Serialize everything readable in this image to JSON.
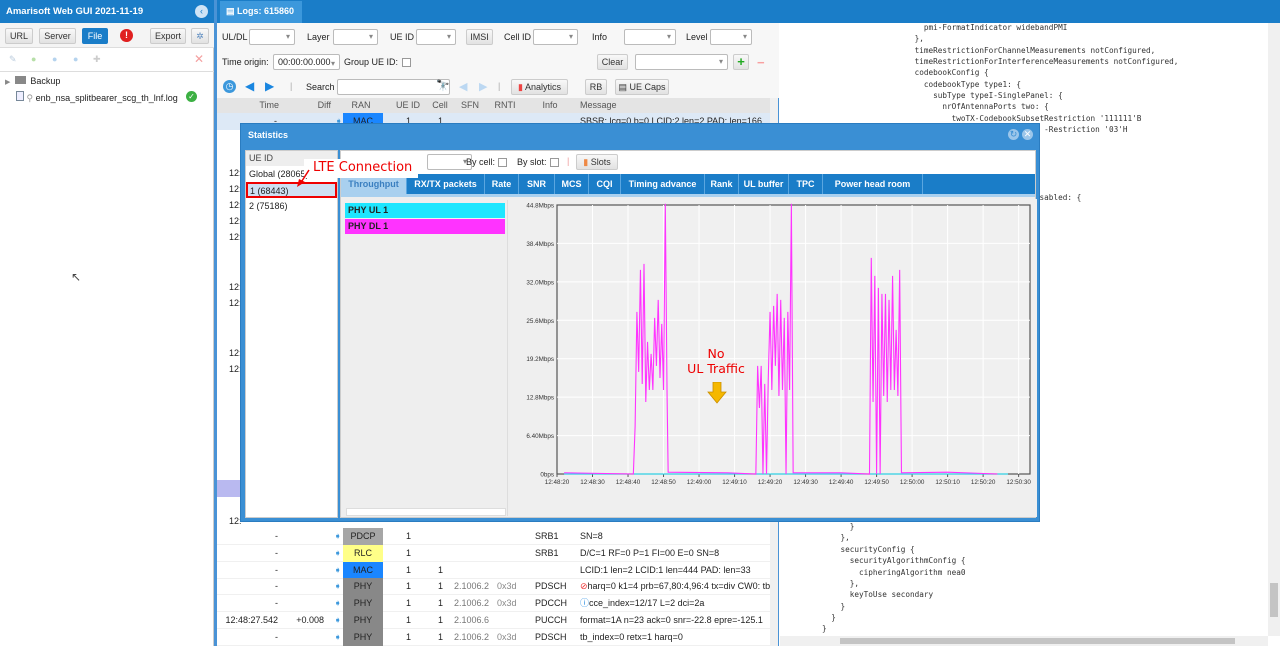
{
  "left": {
    "title": "Amarisoft Web GUI 2021-11-19",
    "buttons": {
      "url": "URL",
      "server": "Server",
      "file": "File",
      "export": "Export"
    },
    "tree": {
      "folder": "Backup",
      "file": "enb_nsa_splitbearer_scg_th_lnf.log"
    }
  },
  "logs": {
    "tab": "Logs: 615860",
    "filters": {
      "uldl": "UL/DL",
      "layer": "Layer",
      "ueid": "UE ID",
      "imsi": "IMSI",
      "cellid": "Cell ID",
      "info": "Info",
      "level": "Level"
    },
    "time_origin_label": "Time origin:",
    "time_origin": "00:00:00.000",
    "group_ue": "Group UE ID:",
    "clear": "Clear",
    "search_label": "Search",
    "analytics": "Analytics",
    "rb": "RB",
    "uecaps": "UE Caps",
    "columns": [
      "Time",
      "Diff",
      "RAN",
      "UE ID",
      "Cell",
      "SFN",
      "RNTI",
      "Info",
      "Message"
    ],
    "first_row": {
      "time": "-",
      "ran": "MAC",
      "ue": "1",
      "cell": "1",
      "msg": "SBSR: lcg=0 b=0 LCID:2 len=2 PAD: len=166"
    },
    "partial_time": "12:",
    "rows": [
      {
        "time": "-",
        "diff": "",
        "ran": "PDCP",
        "ue": "1",
        "cell": "",
        "sfn": "",
        "rnti": "",
        "info": "SRB1",
        "msg": "SN=8"
      },
      {
        "time": "-",
        "diff": "",
        "ran": "RLC",
        "ue": "1",
        "cell": "",
        "sfn": "",
        "rnti": "",
        "info": "SRB1",
        "msg": "D/C=1 RF=0 P=1 FI=00 E=0 SN=8"
      },
      {
        "time": "-",
        "diff": "",
        "ran": "MAC",
        "ue": "1",
        "cell": "1",
        "sfn": "",
        "rnti": "",
        "info": "",
        "msg": "LCID:1 len=2 LCID:1 len=444 PAD: len=33"
      },
      {
        "time": "-",
        "diff": "",
        "ran": "PHY",
        "ue": "1",
        "cell": "1",
        "sfn": "2.1006.2",
        "rnti": "0x3d",
        "info": "PDSCH",
        "msg": "harq=0 k1=4 prb=67,80:4,96:4 tx=div CW0: tb"
      },
      {
        "time": "-",
        "diff": "",
        "ran": "PHY",
        "ue": "1",
        "cell": "1",
        "sfn": "2.1006.2",
        "rnti": "0x3d",
        "info": "PDCCH",
        "msg": "cce_index=12/17 L=2 dci=2a"
      },
      {
        "time": "12:48:27.542",
        "diff": "+0.008",
        "ran": "PHY",
        "ue": "1",
        "cell": "1",
        "sfn": "2.1006.6",
        "rnti": "",
        "info": "PUCCH",
        "msg": "format=1A n=23 ack=0 snr=-22.8 epre=-125.1"
      },
      {
        "time": "-",
        "diff": "",
        "ran": "PHY",
        "ue": "1",
        "cell": "1",
        "sfn": "2.1006.2",
        "rnti": "0x3d",
        "info": "PDSCH",
        "msg": "tb_index=0 retx=1 harq=0"
      }
    ]
  },
  "ran_colors": {
    "MAC": "#1a86ff",
    "PDCP": "#a6a6a6",
    "RLC": "#ffff88",
    "PHY": "#888888"
  },
  "code": {
    "lines": [
      "                              pmi-FormatIndicator widebandPMI",
      "                            },",
      "                            timeRestrictionForChannelMeasurements notConfigured,",
      "                            timeRestrictionForInterferenceMeasurements notConfigured,",
      "                            codebookConfig {",
      "                              codebookType type1: {",
      "                                subType typeI-SinglePanel: {",
      "                                  nrOfAntennaPorts two: {",
      "                                    twoTX-CodebookSubsetRestriction '111111'B",
      "                                                        -Restriction '03'H",
      "",
      "",
      "",
      "",
      "",
      "                                                       sabled: {",
      "",
      "",
      "",
      "",
      "",
      "",
      "",
      "",
      "",
      "",
      "",
      "",
      "",
      "",
      "",
      "",
      "",
      "",
      "",
      "",
      "",
      "",
      "",
      "",
      "",
      "",
      "",
      "",
      "              }",
      "            },",
      "            securityConfig {",
      "              securityAlgorithmConfig {",
      "                cipheringAlgorithm nea0",
      "              },",
      "              keyToUse secondary",
      "            }",
      "          }",
      "        }"
    ]
  },
  "stats": {
    "title": "Statistics",
    "list_header": "UE ID",
    "ues": [
      "Global (28065)",
      "1 (68443)",
      "2 (75186)"
    ],
    "by_cell": "By cell:",
    "by_slot": "By slot:",
    "slots": "Slots",
    "tabs": [
      "Throughput",
      "RX/TX packets",
      "Rate",
      "SNR",
      "MCS",
      "CQI",
      "Timing advance",
      "Rank",
      "UL buffer",
      "TPC",
      "Power head room"
    ],
    "active_tab": "Throughput"
  },
  "annotations": {
    "lte": "LTE Connection",
    "no": "No",
    "ul": "UL Traffic"
  },
  "chart_data": {
    "type": "line",
    "ylim": [
      0,
      44.8
    ],
    "yticks": [
      "0bps",
      "6.40Mbps",
      "12.8Mbps",
      "19.2Mbps",
      "25.6Mbps",
      "32.0Mbps",
      "38.4Mbps",
      "44.8Mbps"
    ],
    "xticks": [
      "12:48:20",
      "12:48:30",
      "12:48:40",
      "12:48:50",
      "12:49:00",
      "12:49:10",
      "12:49:20",
      "12:49:30",
      "12:49:40",
      "12:49:50",
      "12:50:00",
      "12:50:10",
      "12:50:20",
      "12:50:30"
    ],
    "grid": true,
    "legend": "left-panel",
    "series": [
      {
        "name": "PHY UL 1",
        "color": "#1ee6ff",
        "points": [
          [
            "12:48:22",
            0
          ],
          [
            "12:50:27",
            0
          ]
        ]
      },
      {
        "name": "PHY DL 1",
        "color": "#ff33ff",
        "points": [
          [
            "12:48:22",
            0.2
          ],
          [
            "12:48:41.5",
            0
          ],
          [
            "12:48:42",
            8
          ],
          [
            "12:48:42.5",
            27
          ],
          [
            "12:48:43",
            17
          ],
          [
            "12:48:43.5",
            34
          ],
          [
            "12:48:44",
            15
          ],
          [
            "12:48:44.5",
            35
          ],
          [
            "12:48:45",
            12
          ],
          [
            "12:48:45.5",
            22
          ],
          [
            "12:48:46",
            14
          ],
          [
            "12:48:46.5",
            20
          ],
          [
            "12:48:47",
            14
          ],
          [
            "12:48:47.5",
            26
          ],
          [
            "12:48:48",
            18
          ],
          [
            "12:48:48.5",
            29
          ],
          [
            "12:48:49",
            16
          ],
          [
            "12:48:49.5",
            25
          ],
          [
            "12:48:50",
            14
          ],
          [
            "12:48:50.5",
            45
          ],
          [
            "12:48:51",
            13
          ],
          [
            "12:48:51.3",
            0.3
          ],
          [
            "12:49:08",
            0.2
          ],
          [
            "12:49:16",
            0
          ],
          [
            "12:49:16.5",
            18
          ],
          [
            "12:49:17",
            11
          ],
          [
            "12:49:17.5",
            18
          ],
          [
            "12:49:18",
            0
          ],
          [
            "12:49:18.5",
            15
          ],
          [
            "12:49:19",
            0
          ],
          [
            "12:49:19.5",
            16
          ],
          [
            "12:49:20",
            27
          ],
          [
            "12:49:20.5",
            14
          ],
          [
            "12:49:21",
            28
          ],
          [
            "12:49:21.5",
            18
          ],
          [
            "12:49:22",
            30
          ],
          [
            "12:49:22.5",
            13
          ],
          [
            "12:49:23",
            29
          ],
          [
            "12:49:23.5",
            14
          ],
          [
            "12:49:24",
            26
          ],
          [
            "12:49:24.5",
            0
          ],
          [
            "12:49:25",
            27
          ],
          [
            "12:49:25.5",
            14
          ],
          [
            "12:49:26",
            45
          ],
          [
            "12:49:26.5",
            0.2
          ],
          [
            "12:49:40",
            0.2
          ],
          [
            "12:49:48",
            0
          ],
          [
            "12:49:48.5",
            36
          ],
          [
            "12:49:49",
            12
          ],
          [
            "12:49:49.5",
            33
          ],
          [
            "12:49:50",
            0
          ],
          [
            "12:49:50.5",
            31
          ],
          [
            "12:49:51",
            0
          ],
          [
            "12:49:51.5",
            30
          ],
          [
            "12:49:52",
            13
          ],
          [
            "12:49:52.5",
            30
          ],
          [
            "12:49:53",
            12
          ],
          [
            "12:49:53.5",
            29
          ],
          [
            "12:49:54",
            14
          ],
          [
            "12:49:54.5",
            33
          ],
          [
            "12:49:55",
            14
          ],
          [
            "12:49:55.5",
            24
          ],
          [
            "12:49:56",
            13
          ],
          [
            "12:49:56.5",
            34
          ],
          [
            "12:49:57",
            0.2
          ],
          [
            "12:50:10",
            0.3
          ],
          [
            "12:50:24",
            0
          ]
        ]
      }
    ]
  }
}
